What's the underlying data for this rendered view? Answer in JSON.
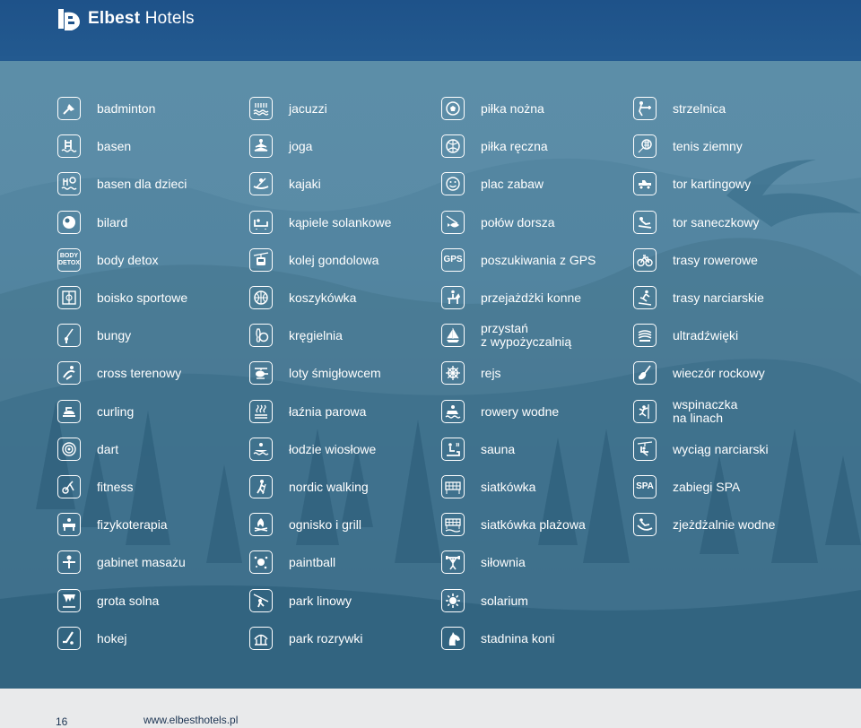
{
  "header": {
    "brand_bold": "Elbest",
    "brand_regular": "Hotels"
  },
  "columns": [
    [
      {
        "icon": "shuttlecock-icon",
        "label": "badminton"
      },
      {
        "icon": "pool-ladder-icon",
        "label": "basen"
      },
      {
        "icon": "kids-pool-icon",
        "label": "basen dla dzieci"
      },
      {
        "icon": "billiard-ball-icon",
        "label": "bilard"
      },
      {
        "icon": "body-detox-icon",
        "label": "body detox",
        "icon_text": [
          "BODY",
          "DETOX"
        ]
      },
      {
        "icon": "sports-field-icon",
        "label": "boisko sportowe"
      },
      {
        "icon": "bungee-icon",
        "label": "bungy"
      },
      {
        "icon": "cross-country-icon",
        "label": "cross terenowy"
      },
      {
        "icon": "curling-stone-icon",
        "label": "curling"
      },
      {
        "icon": "dartboard-icon",
        "label": "dart"
      },
      {
        "icon": "bike-fitness-icon",
        "label": "fitness"
      },
      {
        "icon": "physiotherapy-icon",
        "label": "fizykoterapia"
      },
      {
        "icon": "massage-icon",
        "label": "gabinet masażu"
      },
      {
        "icon": "salt-cave-icon",
        "label": "grota solna"
      },
      {
        "icon": "hockey-stick-icon",
        "label": "hokej"
      }
    ],
    [
      {
        "icon": "jacuzzi-icon",
        "label": "jacuzzi"
      },
      {
        "icon": "yoga-icon",
        "label": "joga"
      },
      {
        "icon": "kayak-icon",
        "label": "kajaki"
      },
      {
        "icon": "salt-bath-icon",
        "label": "kąpiele solankowe"
      },
      {
        "icon": "gondola-icon",
        "label": "kolej gondolowa"
      },
      {
        "icon": "basketball-icon",
        "label": "koszykówka"
      },
      {
        "icon": "bowling-icon",
        "label": "kręgielnia"
      },
      {
        "icon": "helicopter-icon",
        "label": "loty śmigłowcem"
      },
      {
        "icon": "steam-bath-icon",
        "label": "łaźnia parowa"
      },
      {
        "icon": "rowing-boat-icon",
        "label": "łodzie wiosłowe"
      },
      {
        "icon": "nordic-walking-icon",
        "label": "nordic walking"
      },
      {
        "icon": "campfire-icon",
        "label": "ognisko i grill"
      },
      {
        "icon": "paintball-icon",
        "label": "paintball"
      },
      {
        "icon": "zipline-icon",
        "label": "park linowy"
      },
      {
        "icon": "amusement-park-icon",
        "label": "park rozrywki"
      }
    ],
    [
      {
        "icon": "football-icon",
        "label": "piłka nożna"
      },
      {
        "icon": "handball-icon",
        "label": "piłka ręczna"
      },
      {
        "icon": "playground-icon",
        "label": "plac zabaw"
      },
      {
        "icon": "fishing-icon",
        "label": "połów dorsza"
      },
      {
        "icon": "gps-icon",
        "label": "poszukiwania z GPS",
        "icon_text": [
          "GPS"
        ]
      },
      {
        "icon": "horse-rider-icon",
        "label": "przejażdżki konne"
      },
      {
        "icon": "sailboat-icon",
        "label": "przystań",
        "label2": "z wypożyczalnią"
      },
      {
        "icon": "ship-wheel-icon",
        "label": "rejs"
      },
      {
        "icon": "pedal-boat-icon",
        "label": "rowery wodne"
      },
      {
        "icon": "sauna-icon",
        "label": "sauna"
      },
      {
        "icon": "volleyball-net-icon",
        "label": "siatkówka"
      },
      {
        "icon": "beach-volleyball-icon",
        "label": "siatkówka plażowa"
      },
      {
        "icon": "weightlifting-icon",
        "label": "siłownia"
      },
      {
        "icon": "sun-icon",
        "label": "solarium"
      },
      {
        "icon": "horse-head-icon",
        "label": "stadnina koni"
      }
    ],
    [
      {
        "icon": "shooting-icon",
        "label": "strzelnica"
      },
      {
        "icon": "tennis-racket-icon",
        "label": "tenis ziemny"
      },
      {
        "icon": "go-kart-icon",
        "label": "tor kartingowy"
      },
      {
        "icon": "sledge-icon",
        "label": "tor saneczkowy"
      },
      {
        "icon": "bicycle-icon",
        "label": "trasy rowerowe"
      },
      {
        "icon": "skier-icon",
        "label": "trasy narciarskie"
      },
      {
        "icon": "ultrasound-icon",
        "label": "ultradźwięki"
      },
      {
        "icon": "guitar-icon",
        "label": "wieczór rockowy"
      },
      {
        "icon": "climber-icon",
        "label": "wspinaczka",
        "label2": "na linach"
      },
      {
        "icon": "ski-lift-icon",
        "label": "wyciąg narciarski"
      },
      {
        "icon": "spa-icon",
        "label": "zabiegi SPA",
        "icon_text": [
          "SPA"
        ]
      },
      {
        "icon": "water-slide-icon",
        "label": "zjeżdżalnie wodne"
      }
    ]
  ],
  "footer": {
    "page_number": "16",
    "url": "www.elbesthotels.pl"
  },
  "colors": {
    "header": "#1e5289",
    "background": "#5a8ba6",
    "footer": "#e9eaeb",
    "text": "#ffffff"
  }
}
